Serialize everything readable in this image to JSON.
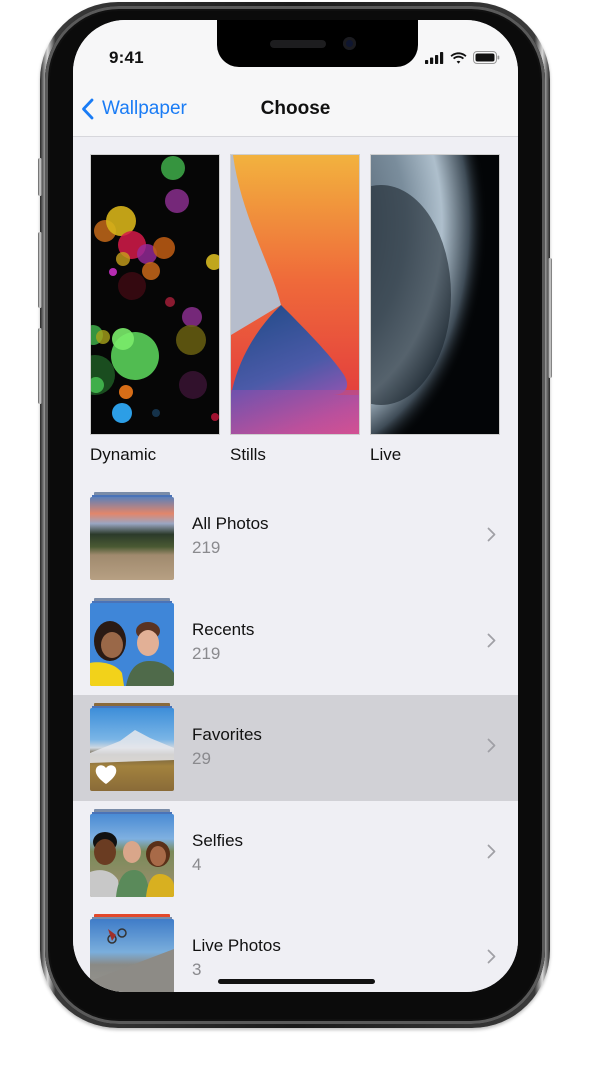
{
  "status_bar": {
    "time": "9:41",
    "icons": [
      "cellular-signal-icon",
      "wifi-icon",
      "battery-icon"
    ]
  },
  "nav": {
    "back_label": "Wallpaper",
    "back_icon": "chevron-left-icon",
    "title": "Choose",
    "accent_color": "#1a7cf5"
  },
  "wallpaper_categories": [
    {
      "label": "Dynamic"
    },
    {
      "label": "Stills"
    },
    {
      "label": "Live"
    }
  ],
  "albums": [
    {
      "name": "All Photos",
      "count": "219",
      "selected": false
    },
    {
      "name": "Recents",
      "count": "219",
      "selected": false
    },
    {
      "name": "Favorites",
      "count": "29",
      "selected": true,
      "badge_icon": "heart-icon"
    },
    {
      "name": "Selfies",
      "count": "4",
      "selected": false
    },
    {
      "name": "Live Photos",
      "count": "3",
      "selected": false
    }
  ]
}
